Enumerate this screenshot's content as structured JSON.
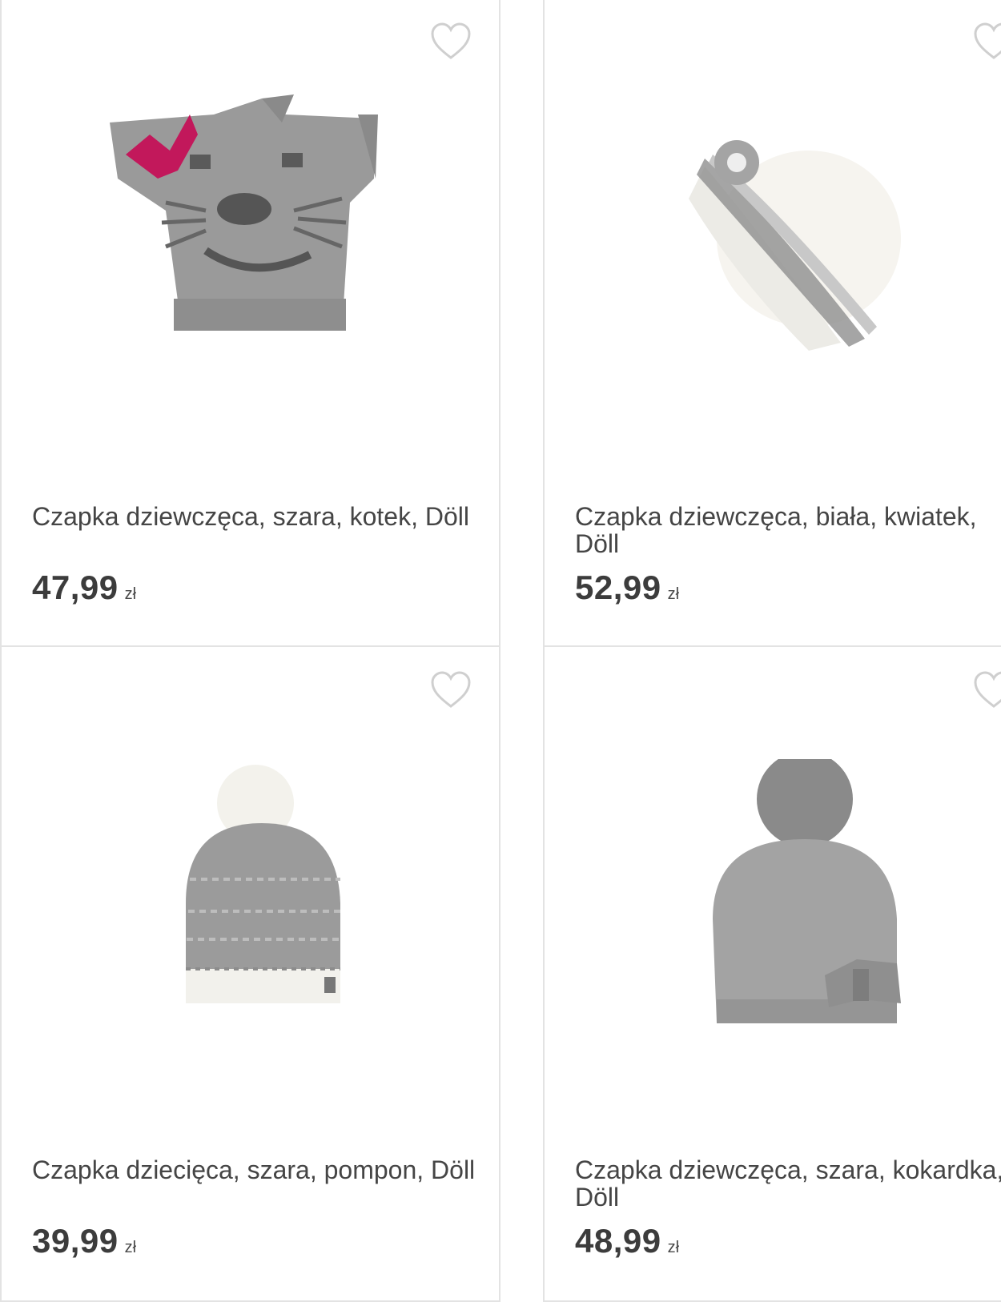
{
  "products": [
    {
      "title": "Czapka dziewczęca, szara, kotek, Döll",
      "price": "47,99",
      "currency": "zł",
      "icon": "heart-outline-icon"
    },
    {
      "title": "Czapka dziewczęca, biała, kwiatek, Döll",
      "price": "52,99",
      "currency": "zł",
      "icon": "heart-outline-icon"
    },
    {
      "title": "Czapka dziecięca, szara, pompon, Döll",
      "price": "39,99",
      "currency": "zł",
      "icon": "heart-outline-icon"
    },
    {
      "title": "Czapka dziewczęca, szara, kokardka, Döll",
      "price": "48,99",
      "currency": "zł",
      "icon": "heart-outline-icon"
    }
  ],
  "colors": {
    "border": "#e3e3e3",
    "heart": "#cfcfcf",
    "text": "#454545",
    "accent_bow": "#c2185b"
  }
}
